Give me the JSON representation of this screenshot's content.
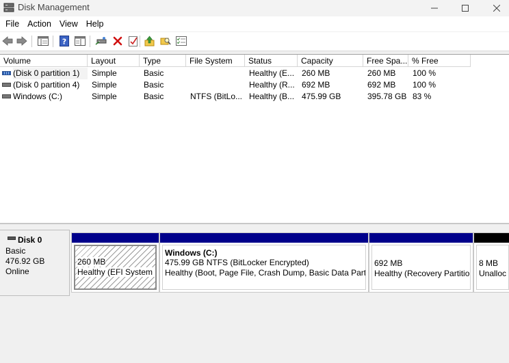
{
  "window": {
    "title": "Disk Management"
  },
  "menu": [
    "File",
    "Action",
    "View",
    "Help"
  ],
  "toolbar": {
    "buttons": [
      "back-arrow-icon",
      "forward-arrow-icon",
      "console-tree-icon",
      "help-icon",
      "properties-pane-icon",
      "connect-disk-icon",
      "delete-icon",
      "checklist-icon",
      "up-folder-icon",
      "search-folder-icon",
      "list-properties-icon"
    ]
  },
  "volumes": {
    "columns": [
      "Volume",
      "Layout",
      "Type",
      "File System",
      "Status",
      "Capacity",
      "Free Spa...",
      "% Free"
    ],
    "rows": [
      {
        "volume": "(Disk 0 partition 1)",
        "layout": "Simple",
        "type": "Basic",
        "fs": "",
        "status": "Healthy (E...",
        "capacity": "260 MB",
        "free": "260 MB",
        "pct": "100 %"
      },
      {
        "volume": "(Disk 0 partition 4)",
        "layout": "Simple",
        "type": "Basic",
        "fs": "",
        "status": "Healthy (R...",
        "capacity": "692 MB",
        "free": "692 MB",
        "pct": "100 %"
      },
      {
        "volume": "Windows (C:)",
        "layout": "Simple",
        "type": "Basic",
        "fs": "NTFS (BitLo...",
        "status": "Healthy (B...",
        "capacity": "475.99 GB",
        "free": "395.78 GB",
        "pct": "83 %"
      }
    ]
  },
  "disk": {
    "name": "Disk 0",
    "type": "Basic",
    "size": "476.92 GB",
    "state": "Online"
  },
  "partitions": [
    {
      "title": "",
      "line1": "260 MB",
      "line2": "Healthy (EFI System P"
    },
    {
      "title": "Windows  (C:)",
      "line1": "475.99 GB NTFS (BitLocker Encrypted)",
      "line2": "Healthy (Boot, Page File, Crash Dump, Basic Data Partit"
    },
    {
      "title": "",
      "line1": "692 MB",
      "line2": "Healthy (Recovery Partitio"
    },
    {
      "title": "",
      "line1": "8 MB",
      "line2": "Unalloc"
    }
  ],
  "colors": {
    "primary_partition_bar": "#00008b",
    "unallocated_bar": "#000000"
  }
}
